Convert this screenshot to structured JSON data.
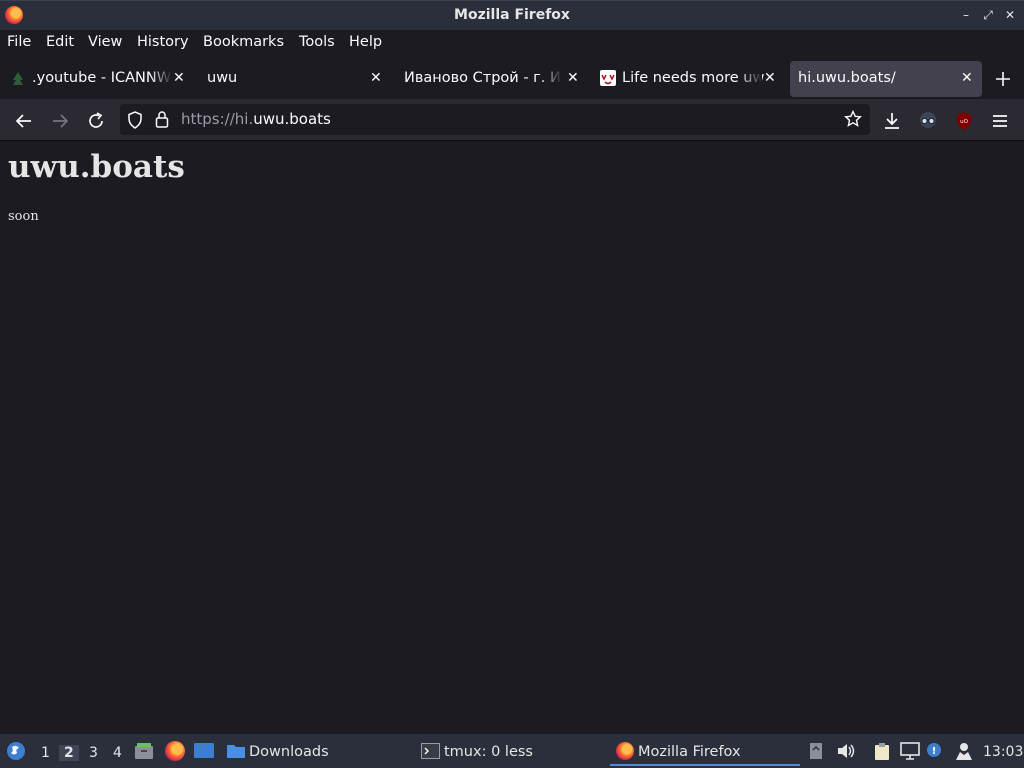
{
  "window": {
    "title": "Mozilla Firefox",
    "controls": [
      "–",
      "⤢",
      "✕"
    ]
  },
  "menu": [
    "File",
    "Edit",
    "View",
    "History",
    "Bookmarks",
    "Tools",
    "Help"
  ],
  "tabs": [
    {
      "label": ".youtube - ICANNWiki",
      "icon": "tree-favicon",
      "active": false
    },
    {
      "label": "uwu",
      "icon": "none",
      "active": false
    },
    {
      "label": "Иваново Строй - г. Иваново",
      "icon": "none",
      "active": false
    },
    {
      "label": "Life needs more uwu",
      "icon": "uwu-favicon",
      "active": false
    },
    {
      "label": "hi.uwu.boats/",
      "icon": "none",
      "active": true
    }
  ],
  "nav": {
    "url_prefix": "https://hi.",
    "url_domain": "uwu.boats"
  },
  "page": {
    "heading": "uwu.boats",
    "body": "soon"
  },
  "taskbar": {
    "workspaces": [
      "1",
      "2",
      "3",
      "4"
    ],
    "active_workspace": "2",
    "tasks": {
      "downloads": "Downloads",
      "tmux": "tmux: 0 less",
      "firefox": "Mozilla Firefox"
    },
    "clock": "13:03"
  },
  "colors": {
    "accent": "#4f8ad4",
    "background": "#1c1b22",
    "toolbar": "#2b2a33"
  }
}
